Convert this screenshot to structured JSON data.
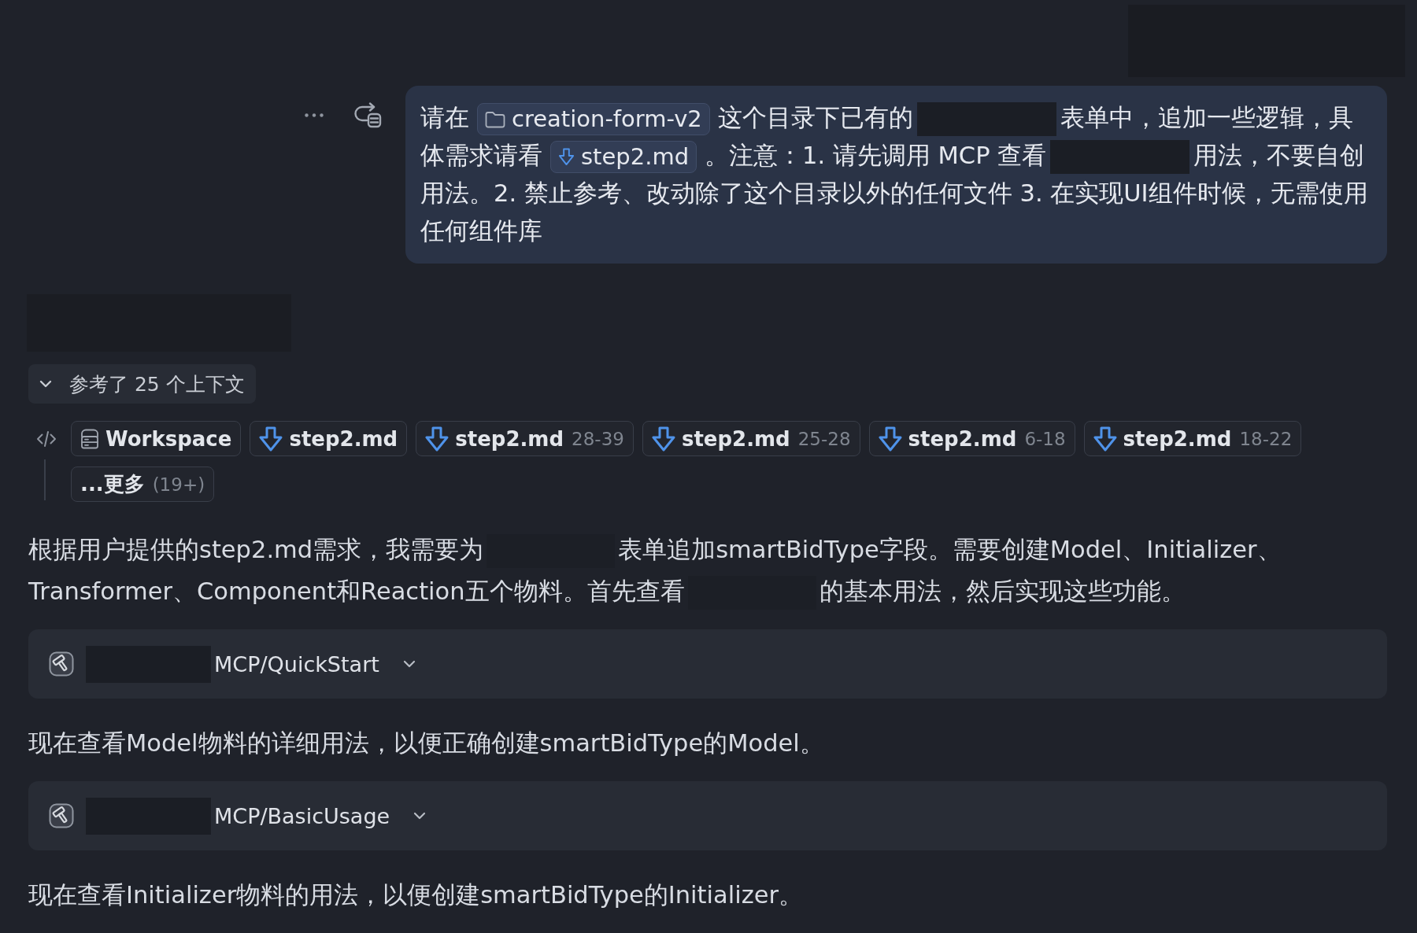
{
  "user_message": {
    "segments": [
      {
        "kind": "text",
        "text": "请在"
      },
      {
        "kind": "folder",
        "text": "creation-form-v2"
      },
      {
        "kind": "text",
        "text": "这个目录下已有的"
      },
      {
        "kind": "redacted"
      },
      {
        "kind": "text",
        "text": "表单中，追加一些逻辑，具体需求请看"
      },
      {
        "kind": "file",
        "text": "step2.md"
      },
      {
        "kind": "text",
        "text": "。注意：1. 请先调用 MCP 查看"
      },
      {
        "kind": "redacted"
      },
      {
        "kind": "text",
        "text": "用法，不要自创用法。2. 禁止参考、改动除了这个目录以外的任何文件 3. 在实现UI组件时候，无需使用任何组件库"
      }
    ]
  },
  "context": {
    "summary": "参考了 25 个上下文",
    "expanded": true,
    "items": [
      {
        "kind": "workspace",
        "name": "Workspace"
      },
      {
        "kind": "file",
        "name": "step2.md"
      },
      {
        "kind": "file",
        "name": "step2.md",
        "lines": "28-39"
      },
      {
        "kind": "file",
        "name": "step2.md",
        "lines": "25-28"
      },
      {
        "kind": "file",
        "name": "step2.md",
        "lines": "6-18"
      },
      {
        "kind": "file",
        "name": "step2.md",
        "lines": "18-22"
      },
      {
        "kind": "more",
        "name": "...更多",
        "count": "(19+)"
      }
    ]
  },
  "messages": [
    {
      "kind": "paragraph",
      "segments": [
        {
          "kind": "text",
          "text": "根据用户提供的step2.md需求，我需要为"
        },
        {
          "kind": "redacted"
        },
        {
          "kind": "text",
          "text": "表单追加smartBidType字段。需要创建Model、Initializer、Transformer、Component和Reaction五个物料。首先查看"
        },
        {
          "kind": "redacted"
        },
        {
          "kind": "text",
          "text": "的基本用法，然后实现这些功能。"
        }
      ]
    },
    {
      "kind": "tool_call",
      "redacted_prefix": true,
      "name": "MCP/QuickStart",
      "expanded": false
    },
    {
      "kind": "paragraph",
      "segments": [
        {
          "kind": "text",
          "text": "现在查看Model物料的详细用法，以便正确创建smartBidType的Model。"
        }
      ]
    },
    {
      "kind": "tool_call",
      "redacted_prefix": true,
      "name": "MCP/BasicUsage",
      "expanded": false
    },
    {
      "kind": "paragraph",
      "segments": [
        {
          "kind": "text",
          "text": "现在查看Initializer物料的用法，以便创建smartBidType的Initializer。"
        }
      ]
    }
  ]
}
